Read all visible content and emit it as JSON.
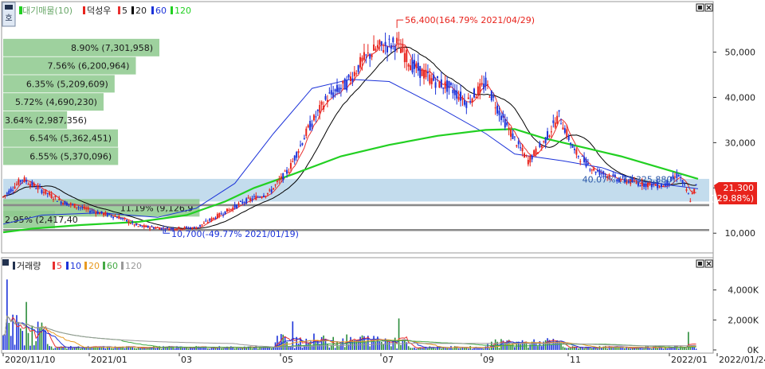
{
  "window": {
    "corner_icon": "settings-corner-icon",
    "legend_price": [
      "대기매물(10)",
      "덕성우",
      "5",
      "20",
      "60",
      "120"
    ],
    "legend_volume": [
      "거래량",
      "5",
      "10",
      "20",
      "60",
      "120"
    ],
    "buttons": [
      "restore-icon",
      "close-icon"
    ]
  },
  "colors": {
    "up": "#e8231c",
    "down": "#1c33d9",
    "ma5": "#e83030",
    "ma20": "#000000",
    "ma60": "#1c33d9",
    "ma120": "#22d022",
    "vp_bar": "#8dc98d",
    "band": "#b8d6ea",
    "vol_ma10": "#1c33d9",
    "vol_ma20": "#e89a20",
    "vol_ma60": "#44aa44",
    "vol_ma120": "#999999"
  },
  "chart_data": [
    {
      "type": "candlestick",
      "title": "덕성우",
      "y_ticks": [
        "50,000",
        "40,000",
        "30,000",
        "20,000",
        "10,000"
      ],
      "ylim": [
        6000,
        58000
      ],
      "x_ticks": [
        "2020/11/10",
        "2021/01",
        "03",
        "05",
        "07",
        "09",
        "11",
        "2022/01",
        "2022/01/24"
      ],
      "annotations": {
        "high": "56,400(164.79% 2021/04/29)",
        "low": "10,700(-49.77% 2021/01/19)",
        "band_label": "40.07% (33,325,880)",
        "last_price": "21,300",
        "last_change": "( 29.88%)"
      },
      "volume_profile": [
        {
          "label": "8.90% (7,301,958)",
          "price": 51000,
          "share": 8.9
        },
        {
          "label": "7.56% (6,200,964)",
          "price": 47000,
          "share": 7.56
        },
        {
          "label": "6.35% (5,209,609)",
          "price": 43000,
          "share": 6.35
        },
        {
          "label": "5.72% (4,690,230)",
          "price": 39000,
          "share": 5.72
        },
        {
          "label": "3.64% (2,987,356)",
          "price": 35000,
          "share": 3.64
        },
        {
          "label": "6.54% (5,362,451)",
          "price": 31000,
          "share": 6.54
        },
        {
          "label": "6.55% (5,370,096)",
          "price": 27000,
          "share": 6.55
        },
        {
          "label": "11.19% (9,126,9",
          "price": 15600,
          "share": 11.19
        },
        {
          "label": "2.95% (2,417,40",
          "price": 13000,
          "share": 2.95
        }
      ],
      "band_range": [
        17000,
        22000
      ],
      "levels": [
        16200,
        10700
      ],
      "series_ma120": [
        [
          0,
          10200
        ],
        [
          15,
          11000
        ],
        [
          40,
          11800
        ],
        [
          70,
          12500
        ],
        [
          95,
          14000
        ],
        [
          115,
          17000
        ],
        [
          130,
          20000
        ],
        [
          150,
          23000
        ],
        [
          175,
          27000
        ],
        [
          200,
          29500
        ],
        [
          225,
          31500
        ],
        [
          250,
          32800
        ],
        [
          265,
          33000
        ],
        [
          280,
          31000
        ],
        [
          300,
          29000
        ],
        [
          320,
          27000
        ],
        [
          340,
          24500
        ],
        [
          360,
          22000
        ]
      ],
      "series_ma60": [
        [
          0,
          12000
        ],
        [
          20,
          14000
        ],
        [
          50,
          14500
        ],
        [
          80,
          13500
        ],
        [
          100,
          15500
        ],
        [
          120,
          21000
        ],
        [
          140,
          32000
        ],
        [
          160,
          42000
        ],
        [
          180,
          44000
        ],
        [
          200,
          43500
        ],
        [
          225,
          38000
        ],
        [
          250,
          32000
        ],
        [
          265,
          27500
        ],
        [
          290,
          26000
        ],
        [
          310,
          24500
        ],
        [
          330,
          21500
        ],
        [
          360,
          19800
        ]
      ]
    },
    {
      "type": "bar",
      "title": "거래량",
      "y_ticks": [
        "4,000K",
        "2,000K",
        "0K"
      ],
      "ylim": [
        0,
        5200
      ]
    }
  ]
}
